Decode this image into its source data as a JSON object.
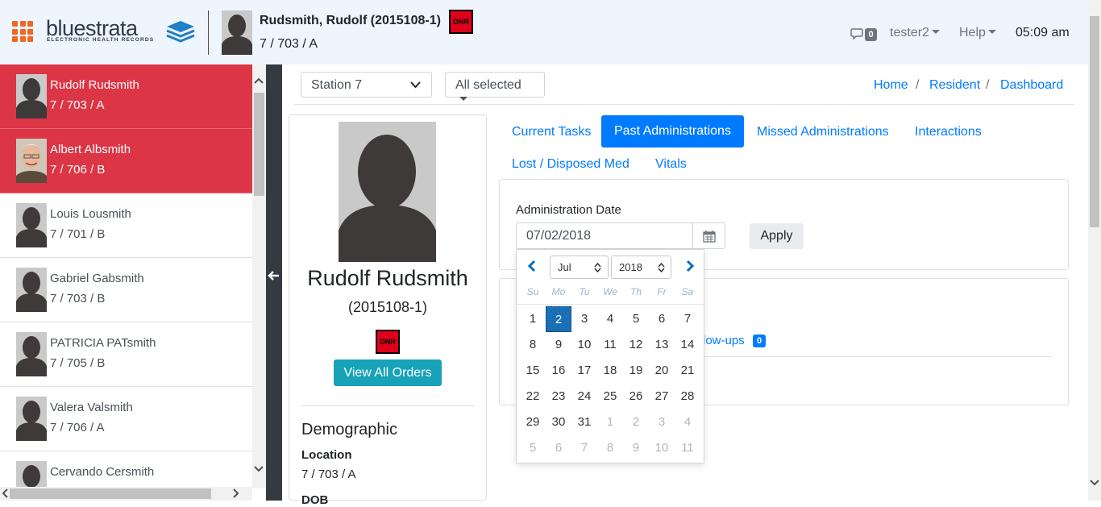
{
  "header": {
    "logo_text": "bluestrata",
    "logo_subtitle": "ELECTRONIC HEALTH RECORDS",
    "patient_name": "Rudsmith, Rudolf (2015108-1)",
    "patient_location": "7 / 703 / A",
    "dnr_label": "DNR",
    "message_count": "0",
    "user": "tester2",
    "help": "Help",
    "time": "05:09 am"
  },
  "sidebar": {
    "residents": [
      {
        "name": "Rudolf Rudsmith",
        "location": "7 / 703 / A",
        "active": true
      },
      {
        "name": "Albert Albsmith",
        "location": "7 / 706 / B",
        "active": true
      },
      {
        "name": "Louis Lousmith",
        "location": "7 / 701 / B",
        "active": false
      },
      {
        "name": "Gabriel Gabsmith",
        "location": "7 / 703 / B",
        "active": false
      },
      {
        "name": "PATRICIA PATsmith",
        "location": "7 / 705 / B",
        "active": false
      },
      {
        "name": "Valera Valsmith",
        "location": "7 / 706 / A",
        "active": false
      },
      {
        "name": "Cervando Cersmith",
        "location": "",
        "active": false
      }
    ]
  },
  "filters": {
    "station": "Station 7",
    "selection": "All selected"
  },
  "breadcrumb": [
    "Home",
    "Resident",
    "Dashboard"
  ],
  "profile": {
    "name": "Rudolf Rudsmith",
    "id": "(2015108-1)",
    "dnr_label": "DNR",
    "view_orders": "View All Orders",
    "demographic_heading": "Demographic",
    "location_label": "Location",
    "location_value": "7 / 703 / A",
    "dob_label": "DOB"
  },
  "tabs": [
    "Current Tasks",
    "Past Administrations",
    "Missed Administrations",
    "Interactions",
    "Lost / Disposed Med",
    "Vitals"
  ],
  "admin_date": {
    "label": "Administration Date",
    "value": "07/02/2018",
    "apply": "Apply"
  },
  "datepicker": {
    "month": "Jul",
    "year": "2018",
    "weekdays": [
      "Su",
      "Mo",
      "Tu",
      "We",
      "Th",
      "Fr",
      "Sa"
    ],
    "days": [
      [
        "1",
        "2",
        "3",
        "4",
        "5",
        "6",
        "7"
      ],
      [
        "8",
        "9",
        "10",
        "11",
        "12",
        "13",
        "14"
      ],
      [
        "15",
        "16",
        "17",
        "18",
        "19",
        "20",
        "21"
      ],
      [
        "22",
        "23",
        "24",
        "25",
        "26",
        "27",
        "28"
      ],
      [
        "29",
        "30",
        "31",
        "1",
        "2",
        "3",
        "4"
      ],
      [
        "5",
        "6",
        "7",
        "8",
        "9",
        "10",
        "11"
      ]
    ],
    "selected_day": "2"
  },
  "followups": {
    "label": "low-ups",
    "count": "0"
  },
  "colors": {
    "accent": "#007bff",
    "active_resident": "#dc3545",
    "teal_button": "#17a2b8",
    "logo_grid": "#f26522",
    "header_bg": "#eef5fc"
  }
}
